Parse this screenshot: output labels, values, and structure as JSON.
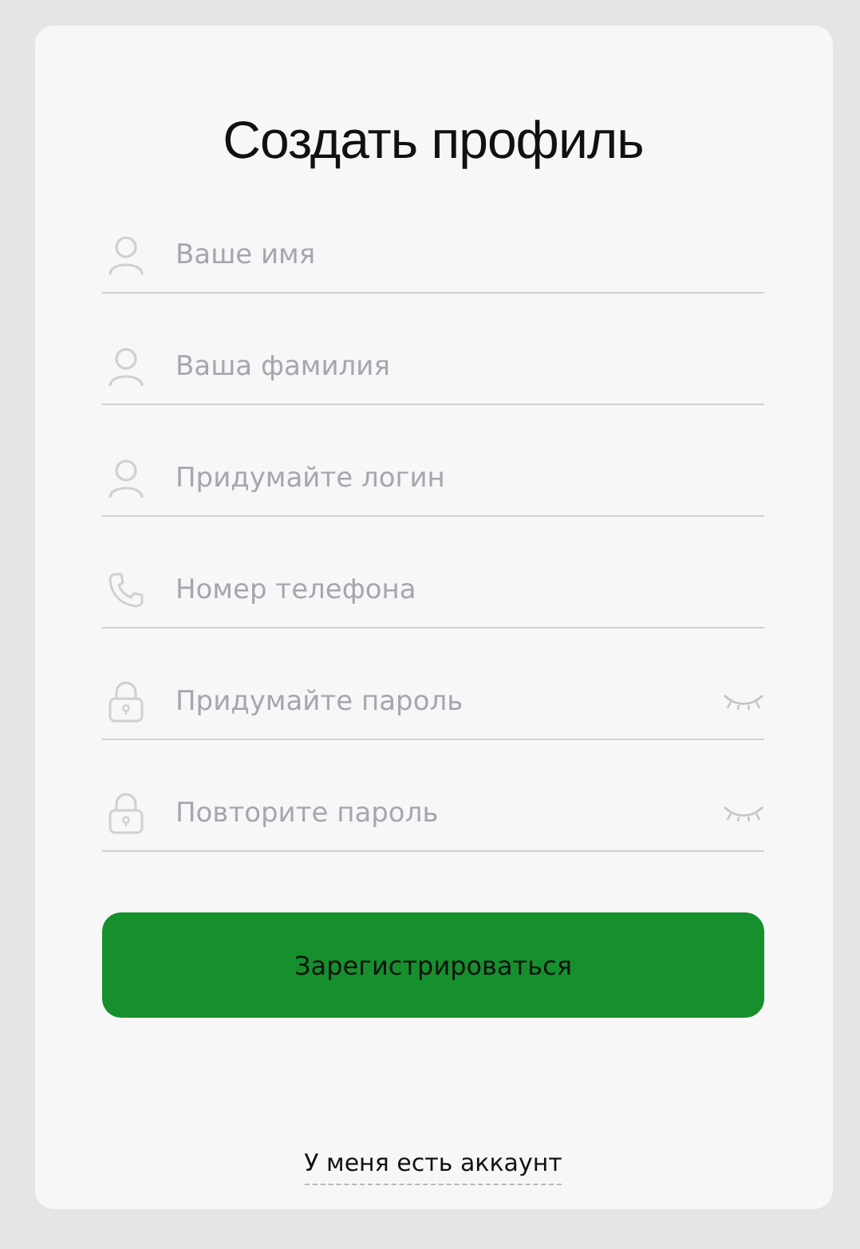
{
  "title": "Создать профиль",
  "fields": [
    {
      "kind": "name",
      "placeholder": "Ваше имя"
    },
    {
      "kind": "name",
      "placeholder": "Ваша фамилия"
    },
    {
      "kind": "name",
      "placeholder": "Придумайте логин"
    },
    {
      "kind": "phone",
      "placeholder": "Номер телефона"
    },
    {
      "kind": "password",
      "placeholder": "Придумайте пароль"
    },
    {
      "kind": "password",
      "placeholder": "Повторите пароль"
    }
  ],
  "submit_button": "Зарегистрироваться",
  "login_link": "У меня есть аккаунт"
}
